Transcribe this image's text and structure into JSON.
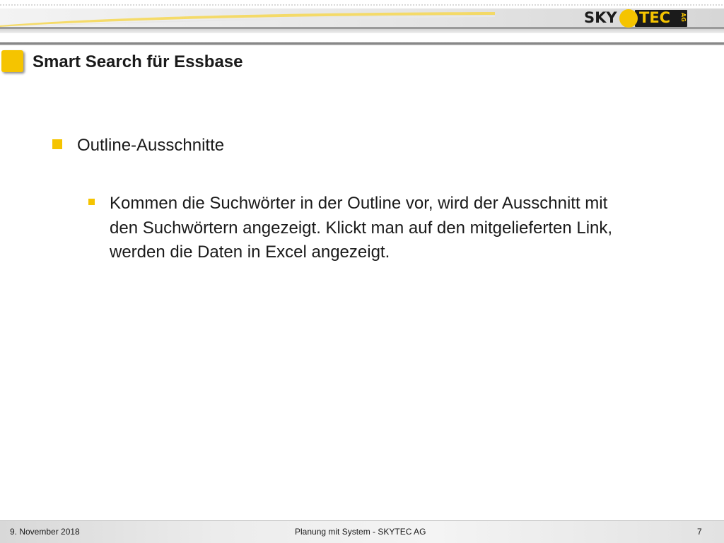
{
  "header": {
    "logo": {
      "word_left": "SKY",
      "word_right": "TEC",
      "suffix": "AG",
      "colors": {
        "dark": "#1b1b1b",
        "accent": "#f5c400"
      }
    }
  },
  "slide": {
    "title": "Smart Search für Essbase",
    "accent_color": "#f5c400",
    "bullets": [
      {
        "text": "Outline-Ausschnitte",
        "children": [
          {
            "lines": [
              "Kommen die Suchwörter in der Outline vor, wird der Ausschnitt mit",
              "den Suchwörtern angezeigt. Klickt man auf den mitgelieferten Link,",
              "werden die Daten in Excel angezeigt."
            ]
          }
        ]
      }
    ]
  },
  "footer": {
    "date": "9. November 2018",
    "center": "Planung mit System - SKYTEC AG",
    "page_number": "7"
  }
}
